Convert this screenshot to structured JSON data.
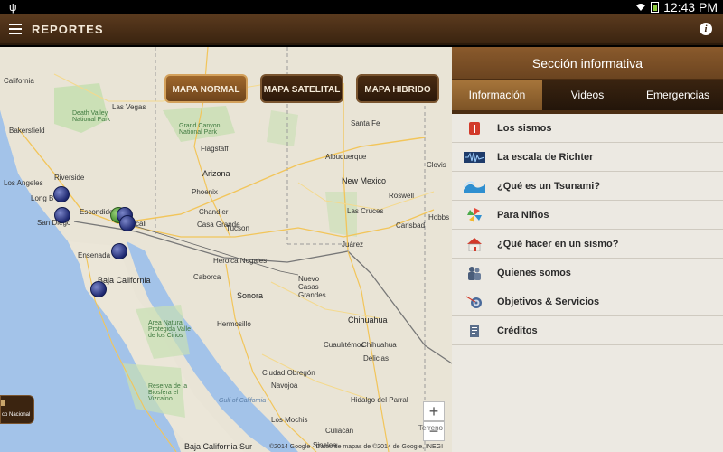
{
  "status_bar": {
    "time": "12:43 PM"
  },
  "app_bar": {
    "title": "REPORTES"
  },
  "map": {
    "buttons": [
      "MAPA NORMAL",
      "MAPA SATELITAL",
      "MAPA HIBRIDO"
    ],
    "active_button": "MAPA NORMAL",
    "labels": {
      "california": "California",
      "las_vegas": "Las Vegas",
      "death_valley": "Death Valley National Park",
      "bakersfield": "Bakersfield",
      "grand_canyon": "Grand Canyon National Park",
      "flagstaff": "Flagstaff",
      "riverside": "Riverside",
      "los_angeles": "Los Angeles",
      "long_beach": "Long B",
      "arizona": "Arizona",
      "phoenix": "Phoenix",
      "escondido": "Escondido",
      "san_diego": "San Diego",
      "mexicali": "cali",
      "chandler": "Chandler",
      "tucson": "Tucson",
      "casa_grande": "Casa Grande",
      "santa_fe": "Santa Fe",
      "albuquerque": "Albuquerque",
      "new_mexico": "New Mexico",
      "roswell": "Roswell",
      "clovis": "Clovis",
      "las_cruces": "Las Cruces",
      "carlsbad": "Carlsbad",
      "hobbs": "Hobbs",
      "juarez": "Juárez",
      "ensenada": "Ensenada",
      "heroica_nogales": "Heroica Nogales",
      "caborca": "Caborca",
      "nuevo_casas_grandes": "Nuevo Casas Grandes",
      "baja_california": "Baja California",
      "sonora": "Sonora",
      "hermosillo": "Hermosillo",
      "chihuahua": "Chihuahua",
      "chihuahua_city": "Chihuahua",
      "cuauhtemoc": "Cuauhtémoc",
      "delicias": "Delicias",
      "ciudad_obregon": "Ciudad Obregón",
      "navojoa": "Navojoa",
      "hidalgo_parral": "Hidalgo del Parral",
      "area_natural": "Area Natural Protegida Valle de los Cirios",
      "reserva": "Reserva de la Biosfera el Vizcaíno",
      "gulf": "Gulf of California",
      "los_mochis": "Los Mochis",
      "culiacan": "Culiacán",
      "baja_california_sur": "Baja California Sur",
      "sinaloa": "Sinaloa",
      "parque_nacional": "co Nacional"
    },
    "terrain_label": "Terreno",
    "attribution": "©2014 Google · Datos de mapas de ©2014 de Google, INEGI",
    "zoom_in": "+",
    "zoom_out": "−"
  },
  "panel": {
    "title": "Sección informativa",
    "tabs": [
      "Información",
      "Videos",
      "Emergencias"
    ],
    "active_tab": "Información",
    "items": [
      {
        "label": "Los sismos",
        "icon": "info-alert-icon"
      },
      {
        "label": "La escala de Richter",
        "icon": "seismograph-icon"
      },
      {
        "label": "¿Qué es un Tsunami?",
        "icon": "wave-icon"
      },
      {
        "label": "Para Niños",
        "icon": "pinwheel-icon"
      },
      {
        "label": "¿Qué hacer en un sismo?",
        "icon": "house-icon"
      },
      {
        "label": "Quienes somos",
        "icon": "people-icon"
      },
      {
        "label": "Objetivos & Servicios",
        "icon": "target-icon"
      },
      {
        "label": "Créditos",
        "icon": "document-icon"
      }
    ]
  },
  "colors": {
    "accent": "#6b4420",
    "active_tab": "#a7763b",
    "marker": "#1e2870"
  }
}
